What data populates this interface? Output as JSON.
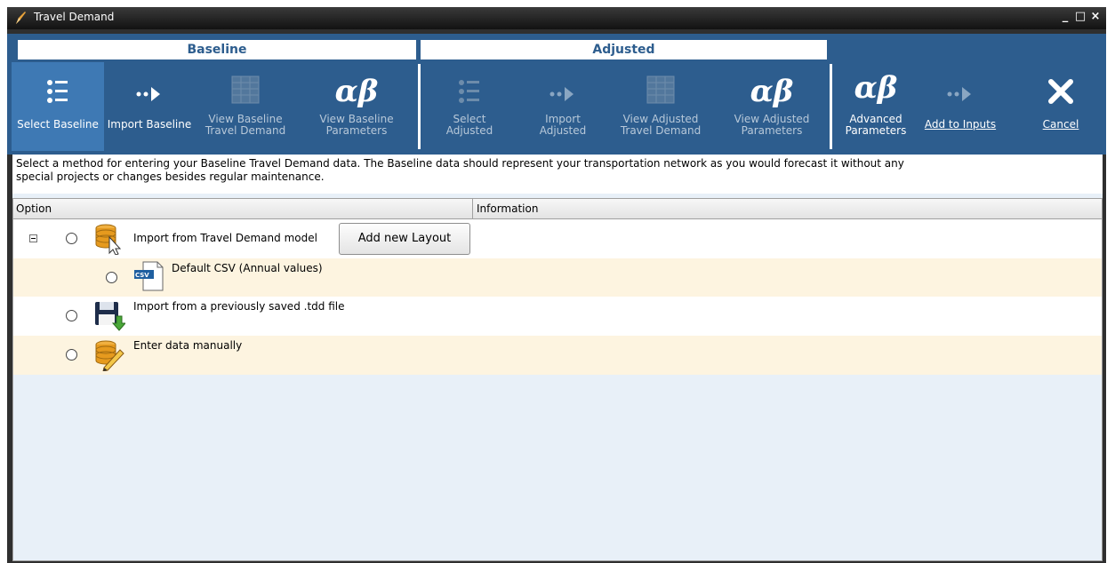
{
  "window": {
    "title": "Travel Demand",
    "minimize": "_",
    "maximize": "□",
    "close": "×"
  },
  "ribbon": {
    "groups": {
      "baseline": "Baseline",
      "adjusted": "Adjusted"
    },
    "buttons": {
      "select_baseline": "Select Baseline",
      "import_baseline": "Import Baseline",
      "view_baseline_td": [
        "View Baseline",
        "Travel Demand"
      ],
      "view_baseline_params": [
        "View Baseline",
        "Parameters"
      ],
      "select_adjusted": [
        "Select",
        "Adjusted"
      ],
      "import_adjusted": [
        "Import",
        "Adjusted"
      ],
      "view_adjusted_td": [
        "View Adjusted",
        "Travel Demand"
      ],
      "view_adjusted_params": [
        "View Adjusted",
        "Parameters"
      ],
      "advanced_params": [
        "Advanced",
        "Parameters"
      ],
      "add_to_inputs": "Add to Inputs",
      "cancel": "Cancel"
    },
    "greek_glyph": "αβ"
  },
  "info": {
    "line1": "Select a method for entering your Baseline Travel Demand data.  The Baseline data should represent your transportation network as you would forecast it without any",
    "line2": "special projects or changes besides regular maintenance."
  },
  "grid": {
    "columns": [
      "Option",
      "Information"
    ],
    "rows": [
      {
        "label": "Import from Travel Demand model",
        "button": "Add new Layout",
        "icon": "database-cursor-icon"
      },
      {
        "label": "Default CSV (Annual values)",
        "icon": "csv-file-icon",
        "badge": "CSV"
      },
      {
        "label": "Import from a previously saved .tdd file",
        "icon": "save-disk-icon"
      },
      {
        "label": "Enter data manually",
        "icon": "database-pencil-icon"
      }
    ]
  },
  "colors": {
    "ribbon": "#2d5d8e",
    "active": "#3e79b4",
    "cream_row": "#fdf4e0",
    "grid_bg": "#e8f0f8"
  }
}
